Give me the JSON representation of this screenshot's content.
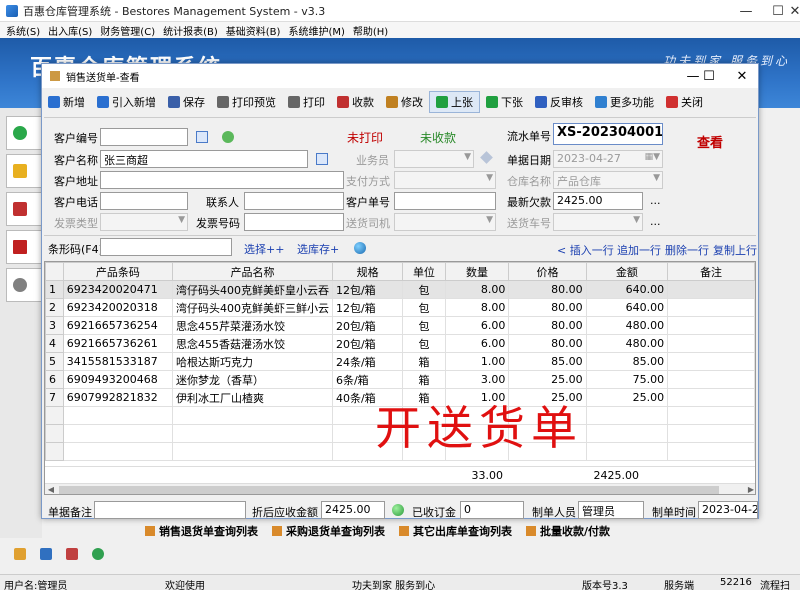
{
  "main_window": {
    "title": "百惠仓库管理系统 - Bestores Management System - v3.3",
    "controls": {
      "minimize": "—",
      "maximize": "☐",
      "close": "✕"
    },
    "menu": [
      "系统(S)",
      "出入库(S)",
      "财务管理(C)",
      "统计报表(B)",
      "基础资料(B)",
      "系统维护(M)",
      "帮助(H)"
    ],
    "banner_title": "百惠仓库管理系统",
    "banner_slogan": "功夫到家 服务到心"
  },
  "dialog": {
    "title": "销售送货单-查看",
    "controls": {
      "minimize": "—",
      "maximize": "☐",
      "close": "✕"
    }
  },
  "toolbar": [
    {
      "key": "new",
      "label": "新增",
      "icon": "plus-icon",
      "color": "#2a6fd0"
    },
    {
      "key": "import",
      "label": "引入新增",
      "icon": "plus-icon",
      "color": "#2a6fd0"
    },
    {
      "key": "save",
      "label": "保存",
      "icon": "save-icon",
      "color": "#3a5fa8"
    },
    {
      "key": "preview",
      "label": "打印预览",
      "icon": "print-preview-icon",
      "color": "#666666"
    },
    {
      "key": "print",
      "label": "打印",
      "icon": "print-icon",
      "color": "#666666"
    },
    {
      "key": "receive",
      "label": "收款",
      "icon": "coins-icon",
      "color": "#c03030"
    },
    {
      "key": "edit",
      "label": "修改",
      "icon": "edit-icon",
      "color": "#c08020"
    },
    {
      "key": "prev",
      "label": "上张",
      "icon": "arrow-up-icon",
      "color": "#20a040"
    },
    {
      "key": "next",
      "label": "下张",
      "icon": "arrow-down-icon",
      "color": "#20a040"
    },
    {
      "key": "unaudit",
      "label": "反审核",
      "icon": "unaudit-icon",
      "color": "#3060c0"
    },
    {
      "key": "more",
      "label": "更多功能",
      "icon": "more-icon",
      "color": "#3080d0"
    },
    {
      "key": "close",
      "label": "关闭",
      "icon": "close-icon",
      "color": "#d03030"
    }
  ],
  "form": {
    "customer_code_label": "客户编号",
    "customer_code": "",
    "customer_name_label": "客户名称",
    "customer_name": "张三商超",
    "customer_address_label": "客户地址",
    "customer_address": "",
    "customer_phone_label": "客户电话",
    "customer_phone": "",
    "contact_label": "联系人",
    "contact": "",
    "invoice_type_label": "发票类型",
    "invoice_type": "",
    "invoice_no_label": "发票号码",
    "invoice_no": "",
    "print_status": "未打印",
    "collect_status": "未收款",
    "salesman_label": "业务员",
    "salesman": "",
    "payment_label": "支付方式",
    "payment": "",
    "cust_order_label": "客户单号",
    "cust_order": "",
    "driver_label": "送货司机",
    "driver": "",
    "serial_label": "流水单号",
    "serial_no": "XS-202304001",
    "view_label": "查看",
    "date_label": "单据日期",
    "date": "2023-04-27",
    "warehouse_label": "仓库名称",
    "warehouse": "产品仓库",
    "latest_debt_label": "最新欠款",
    "latest_debt": "2425.00",
    "vehicle_label": "送货车号",
    "vehicle": "",
    "ellipsis": "..."
  },
  "barcode_bar": {
    "label": "条形码(F4)",
    "value": "",
    "select_plus": "选择++",
    "select_stock": "选库存+",
    "insert_row": "< 插入一行",
    "add_row": "追加一行",
    "delete_row": "删除一行",
    "copy_row": "复制上行"
  },
  "grid": {
    "columns": [
      "",
      "产品条码",
      "产品名称",
      "规格",
      "单位",
      "数量",
      "价格",
      "金额",
      "备注"
    ],
    "rows": [
      {
        "n": "1",
        "barcode": "6923420020471",
        "name": "湾仔码头400克鲜美虾皇小云吞",
        "spec": "12包/箱",
        "unit": "包",
        "qty": "8.00",
        "price": "80.00",
        "amount": "640.00",
        "note": ""
      },
      {
        "n": "2",
        "barcode": "6923420020318",
        "name": "湾仔码头400克鲜美虾三鲜小云",
        "spec": "12包/箱",
        "unit": "包",
        "qty": "8.00",
        "price": "80.00",
        "amount": "640.00",
        "note": ""
      },
      {
        "n": "3",
        "barcode": "6921665736254",
        "name": "思念455芹菜灌汤水饺",
        "spec": "20包/箱",
        "unit": "包",
        "qty": "6.00",
        "price": "80.00",
        "amount": "480.00",
        "note": ""
      },
      {
        "n": "4",
        "barcode": "6921665736261",
        "name": "思念455香菇灌汤水饺",
        "spec": "20包/箱",
        "unit": "包",
        "qty": "6.00",
        "price": "80.00",
        "amount": "480.00",
        "note": ""
      },
      {
        "n": "5",
        "barcode": "3415581533187",
        "name": "哈根达斯巧克力",
        "spec": "24条/箱",
        "unit": "箱",
        "qty": "1.00",
        "price": "85.00",
        "amount": "85.00",
        "note": ""
      },
      {
        "n": "6",
        "barcode": "6909493200468",
        "name": "迷你梦龙（香草）",
        "spec": "6条/箱",
        "unit": "箱",
        "qty": "3.00",
        "price": "25.00",
        "amount": "75.00",
        "note": ""
      },
      {
        "n": "7",
        "barcode": "6907992821832",
        "name": "伊利冰工厂山楂爽",
        "spec": "40条/箱",
        "unit": "箱",
        "qty": "1.00",
        "price": "25.00",
        "amount": "25.00",
        "note": ""
      }
    ],
    "overlay_text": "开送货单",
    "total_qty": "33.00",
    "total_amount": "2425.00"
  },
  "footer": {
    "remark_label": "单据备注",
    "remark": "",
    "discount_label": "折后应收金额",
    "discount_amount": "2425.00",
    "deposit_label": "已收订金",
    "deposit": "0",
    "creator_label": "制单人员",
    "creator": "管理员",
    "create_time_label": "制单时间",
    "create_time": "2023-04-27"
  },
  "bottom_links": [
    "销售退货单查询列表",
    "采购退货单查询列表",
    "其它出库单查询列表",
    "批量收款/付款"
  ],
  "statusbar": {
    "user": "用户名:管理员",
    "welcome": "欢迎使用",
    "slogan": "功夫到家 服务到心",
    "version": "版本号3.3",
    "server": "服务端",
    "port": "52216",
    "flow": "流程扫"
  }
}
